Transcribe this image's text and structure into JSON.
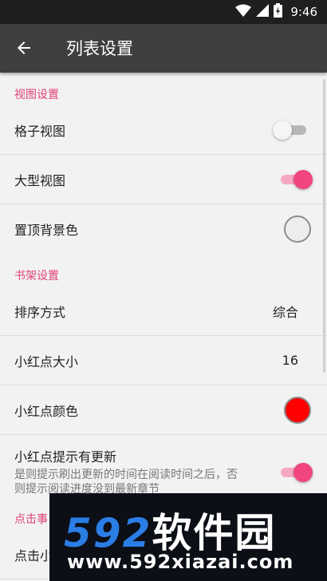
{
  "status_bar": {
    "time": "9:46"
  },
  "app_bar": {
    "title": "列表设置"
  },
  "sections": {
    "view": "视图设置",
    "shelf": "书架设置",
    "click": "点击事"
  },
  "rows": {
    "grid_view": {
      "label": "格子视图",
      "checked": false
    },
    "large_view": {
      "label": "大型视图",
      "checked": true
    },
    "top_bg_color": {
      "label": "置顶背景色",
      "color": "#eeeeee"
    },
    "sort": {
      "label": "排序方式",
      "value": "综合"
    },
    "dot_size": {
      "label": "小红点大小",
      "value": "16"
    },
    "dot_color": {
      "label": "小红点颜色",
      "color": "#ff0000"
    },
    "dot_update": {
      "label": "小红点提示有更新",
      "desc": "是则提示刷出更新的时间在阅读时间之后，否则提示阅读进度没到最新章节",
      "checked": true
    },
    "click_partial": {
      "label": "点击小"
    }
  },
  "watermark": {
    "logo_num": "592",
    "logo_cn": "软件园",
    "url": "www.592xiazai.com"
  },
  "colors": {
    "accent": "#e0417a",
    "appbar": "#3f3f3f",
    "statusbar": "#1f1f1f"
  }
}
